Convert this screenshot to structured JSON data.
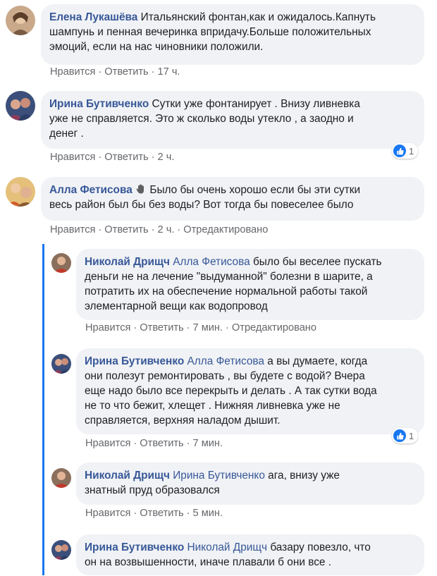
{
  "colors": {
    "author": "#385898",
    "text": "#1c1e21",
    "meta": "#65676b",
    "bubble": "#f0f2f5",
    "like": "#1877f2"
  },
  "actions": {
    "like": "Нравится",
    "reply": "Ответить",
    "edited": "Отредактировано",
    "dot": "·"
  },
  "comments": [
    {
      "author": "Елена Лукашёва",
      "lines": [
        "Итальянский фонтан,как и ожидалось.Капнуть",
        "шампунь и пенная вечеринка впридачу.Больше положительных",
        "эмоций, если на нас чиновники положили."
      ],
      "time": "17 ч."
    },
    {
      "author": "Ирина Бутивченко",
      "lines": [
        "Сутки уже фонтанирует . Внизу ливневка",
        "уже не справляется. Это ж сколько воды утекло , а заодно и",
        "денег ."
      ],
      "time": "2 ч.",
      "reactions": "1"
    },
    {
      "author": "Алла Фетисова",
      "icon": "waving-hand-icon",
      "lines": [
        "Было бы очень хорошо если бы эти сутки",
        "весь район был бы без воды? Вот тогда бы повеселее было"
      ],
      "time": "2 ч."
    }
  ],
  "replies": [
    {
      "author": "Николай Дрищч",
      "mention": "Алла Фетисова",
      "lines": [
        "было бы веселее пускать",
        "деньги не на лечение \"выдуманной\" болезни в шарите, а",
        "потратить их на обеспечение нормальной работы такой",
        "элементарной вещи как водопровод"
      ],
      "time": "7 мин."
    },
    {
      "author": "Ирина Бутивченко",
      "mention": "Алла Фетисова",
      "lines": [
        "а вы думаете, когда",
        "они полезут ремонтировать , вы будете с водой? Вчера",
        "еще надо было все перекрыть и делать . А так сутки вода",
        "не то что бежит, хлещет . Нижняя ливневка уже не",
        "справляется, верхняя наладом дышит."
      ],
      "time": "7 мин.",
      "reactions": "1"
    },
    {
      "author": "Николай Дрищч",
      "mention": "Ирина Бутивченко",
      "lines": [
        "ага, внизу уже",
        "знатный пруд образовался"
      ],
      "time": "5 мин."
    },
    {
      "author": "Ирина Бутивченко",
      "mention": "Николай Дрищч",
      "lines": [
        "базару повезло, что",
        "он на возвышенности, иначе плавали б они все ."
      ]
    }
  ]
}
